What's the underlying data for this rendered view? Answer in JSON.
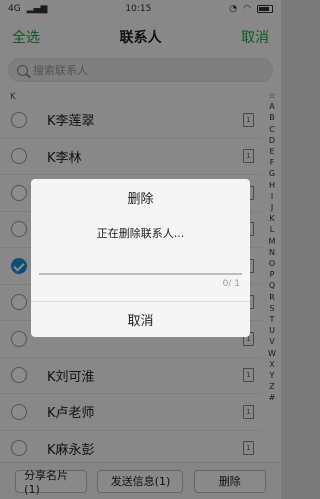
{
  "status": {
    "signal": "4G",
    "time": "10:15"
  },
  "header": {
    "select_all": "全选",
    "title": "联系人",
    "cancel": "取消"
  },
  "search": {
    "placeholder": "搜索联系人"
  },
  "section": "K",
  "contacts": [
    {
      "name": "K李莲翠",
      "checked": false
    },
    {
      "name": "K李林",
      "checked": false
    },
    {
      "name": "",
      "checked": false
    },
    {
      "name": "",
      "checked": false
    },
    {
      "name": "",
      "checked": true
    },
    {
      "name": "",
      "checked": false
    },
    {
      "name": "",
      "checked": false
    },
    {
      "name": "K刘可淮",
      "checked": false
    },
    {
      "name": "K卢老师",
      "checked": false
    },
    {
      "name": "K麻永彭",
      "checked": false
    }
  ],
  "index_letters": [
    "☆",
    "A",
    "B",
    "C",
    "D",
    "E",
    "F",
    "G",
    "H",
    "I",
    "J",
    "K",
    "L",
    "M",
    "N",
    "O",
    "P",
    "Q",
    "R",
    "S",
    "T",
    "U",
    "V",
    "W",
    "X",
    "Y",
    "Z",
    "#"
  ],
  "bottom": {
    "share": "分享名片(1)",
    "send": "发送信息(1)",
    "delete": "删除"
  },
  "dialog": {
    "title": "删除",
    "message": "正在删除联系人...",
    "progress": 0,
    "count": "0/ 1",
    "cancel": "取消"
  }
}
